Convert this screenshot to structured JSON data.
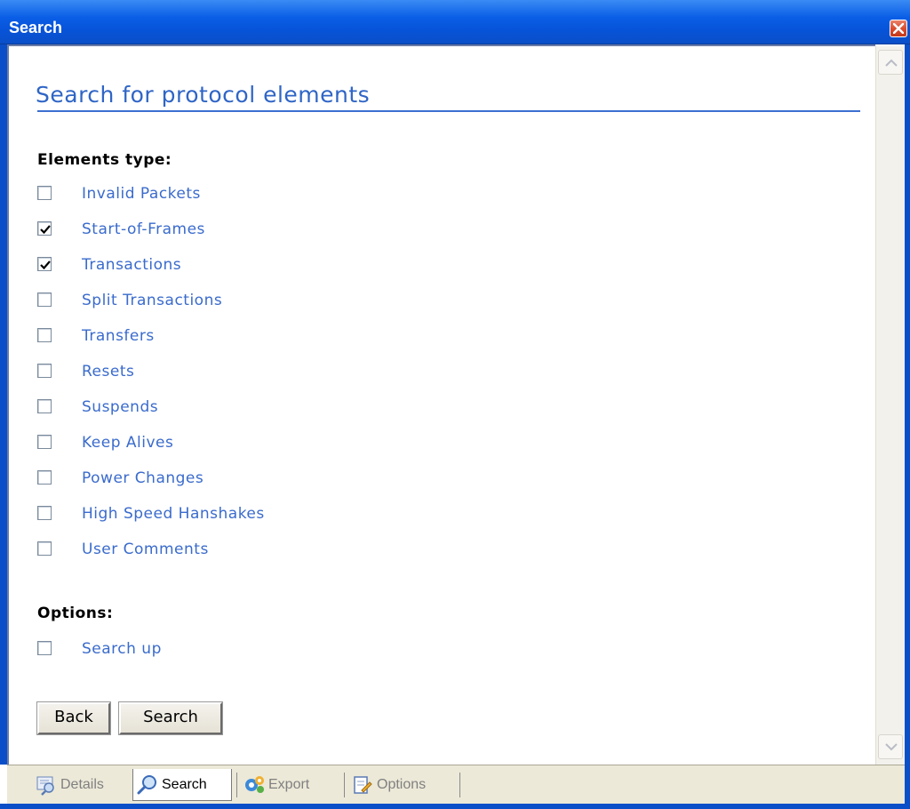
{
  "window": {
    "title": "Search"
  },
  "page": {
    "title": "Search for protocol elements",
    "elements_heading": "Elements type:",
    "options_heading": "Options:"
  },
  "element_types": [
    {
      "label": "Invalid Packets",
      "checked": false
    },
    {
      "label": "Start-of-Frames",
      "checked": true
    },
    {
      "label": "Transactions",
      "checked": true
    },
    {
      "label": "Split Transactions",
      "checked": false
    },
    {
      "label": "Transfers",
      "checked": false
    },
    {
      "label": "Resets",
      "checked": false
    },
    {
      "label": "Suspends",
      "checked": false
    },
    {
      "label": "Keep Alives",
      "checked": false
    },
    {
      "label": "Power Changes",
      "checked": false
    },
    {
      "label": "High Speed Hanshakes",
      "checked": false
    },
    {
      "label": "User Comments",
      "checked": false
    }
  ],
  "options": [
    {
      "label": "Search up",
      "checked": false
    }
  ],
  "buttons": {
    "back": "Back",
    "search": "Search"
  },
  "tabs": [
    {
      "label": "Details",
      "icon": "details-icon",
      "active": false
    },
    {
      "label": "Search",
      "icon": "search-icon",
      "active": true
    },
    {
      "label": "Export",
      "icon": "export-icon",
      "active": false
    },
    {
      "label": "Options",
      "icon": "options-icon",
      "active": false
    }
  ],
  "colors": {
    "title_bar": "#0a5ee6",
    "link_blue": "#3a6bcc",
    "heading_blue": "#2f65c6"
  }
}
